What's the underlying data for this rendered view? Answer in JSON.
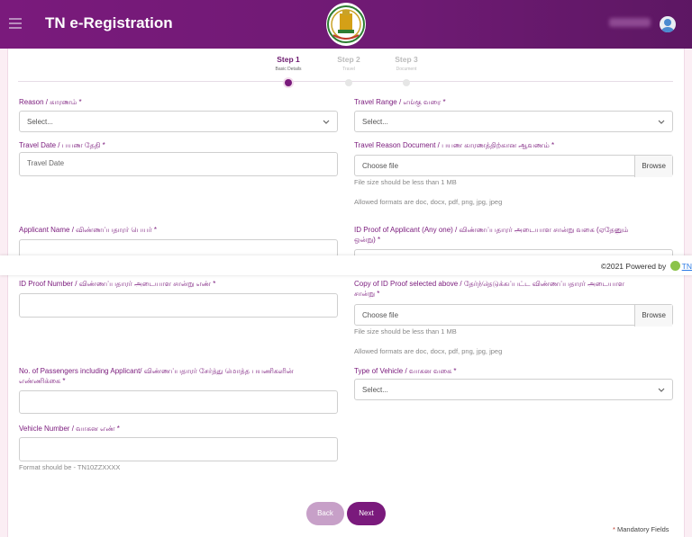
{
  "header": {
    "title": "TN e-Registration",
    "menu_icon": "hamburger-icon",
    "emblem_icon": "tn-emblem-icon",
    "avatar_icon": "user-avatar-icon",
    "bg_color": "#7a1a7c"
  },
  "stepper": [
    {
      "label": "Step 1",
      "sub": "Basic Details",
      "active": true
    },
    {
      "label": "Step 2",
      "sub": "Travel",
      "active": false
    },
    {
      "label": "Step 3",
      "sub": "Document",
      "active": false
    }
  ],
  "form": {
    "reason": {
      "label": "Reason / காரணம் *",
      "value": "Select..."
    },
    "travel_range": {
      "label": "Travel Range / எங்கு வரை *",
      "value": "Select..."
    },
    "travel_date": {
      "label": "Travel Date / பயண தேதி *",
      "placeholder": "Travel Date"
    },
    "travel_doc": {
      "label": "Travel Reason Document / பயண காரணத்திற்கான ஆவணம் *",
      "file_text": "Choose file",
      "browse": "Browse",
      "hint_size": "File size should be less than 1 MB",
      "hint_formats": "Allowed formats are doc, docx, pdf, png, jpg, jpeg"
    },
    "applicant_name": {
      "label": "Applicant Name / விண்ணப்பதாரர் பெயர் *"
    },
    "id_proof": {
      "label_line1": "ID Proof of Applicant (Any one) / விண்ணப்பதாரர் அடையாள சான்று வகை (ஏதேனும்",
      "label_line2": "ஒன்று) *"
    },
    "id_number": {
      "label": "ID Proof Number / விண்ணப்பதாரர் அடையாள சான்று எண் *"
    },
    "id_copy": {
      "label_line1": "Copy of ID Proof selected above / தேர்ந்தெடுக்கப்பட்ட விண்ணப்பதாரர் அடையாள",
      "label_line2": "சான்று *",
      "file_text": "Choose file",
      "browse": "Browse",
      "hint_size": "File size should be less than 1 MB",
      "hint_formats": "Allowed formats are doc, docx, pdf, png, jpg, jpeg"
    },
    "passengers": {
      "label_line1": "No. of Passengers including Applicant/ விண்ணப்பதாரர் சேர்த்து மொத்த பயணிகளின்",
      "label_line2": "எண்ணிக்கை *"
    },
    "vehicle_type": {
      "label": "Type of Vehicle / வாகன வகை *",
      "value": "Select..."
    },
    "vehicle_number": {
      "label": "Vehicle Number / வாகன எண் *",
      "hint": "Format should be - TN10ZZXXXX"
    }
  },
  "footer": {
    "copyright": "©2021 Powered by",
    "link": "TN"
  },
  "buttons": {
    "back": "Back",
    "next": "Next"
  },
  "mandatory_note": "Mandatory Fields",
  "mandatory_star": "*"
}
